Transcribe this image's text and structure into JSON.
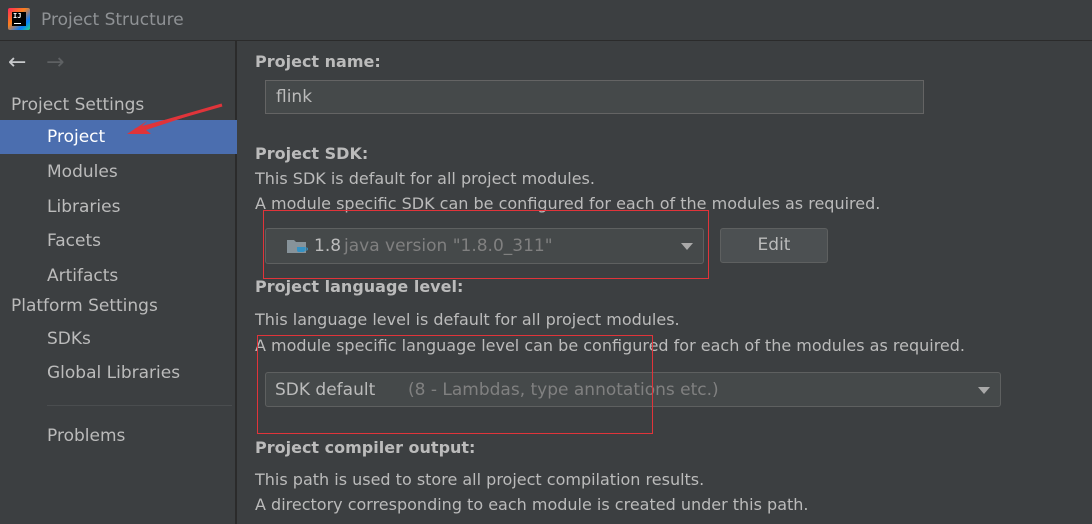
{
  "window": {
    "title": "Project Structure"
  },
  "nav": {
    "back_icon": "arrow-left-icon",
    "forward_icon": "arrow-right-icon"
  },
  "sidebar": {
    "project_settings_header": "Project Settings",
    "project_settings_items": [
      "Project",
      "Modules",
      "Libraries",
      "Facets",
      "Artifacts"
    ],
    "platform_settings_header": "Platform Settings",
    "platform_settings_items": [
      "SDKs",
      "Global Libraries"
    ],
    "problems": "Problems",
    "selected_item": "Project"
  },
  "content": {
    "project_name_label": "Project name:",
    "project_name_value": "flink",
    "sdk_label": "Project SDK:",
    "sdk_desc_1": "This SDK is default for all project modules.",
    "sdk_desc_2": "A module specific SDK can be configured for each of the modules as required.",
    "sdk_selected_name": "1.8",
    "sdk_selected_version": "java version \"1.8.0_311\"",
    "sdk_edit_button": "Edit",
    "lang_label": "Project language level:",
    "lang_desc_1": "This language level is default for all project modules.",
    "lang_desc_2": "A module specific language level can be configured for each of the modules as required.",
    "lang_selected": "SDK default",
    "lang_selected_detail": "(8 - Lambdas, type annotations etc.)",
    "compiler_label": "Project compiler output:",
    "compiler_desc_1": "This path is used to store all project compilation results.",
    "compiler_desc_2": "A directory corresponding to each module is created under this path."
  },
  "colors": {
    "background": "#3c3f41",
    "selection": "#4b6eaf",
    "annotation_red": "#e0343a",
    "text": "#bbbbbb"
  }
}
